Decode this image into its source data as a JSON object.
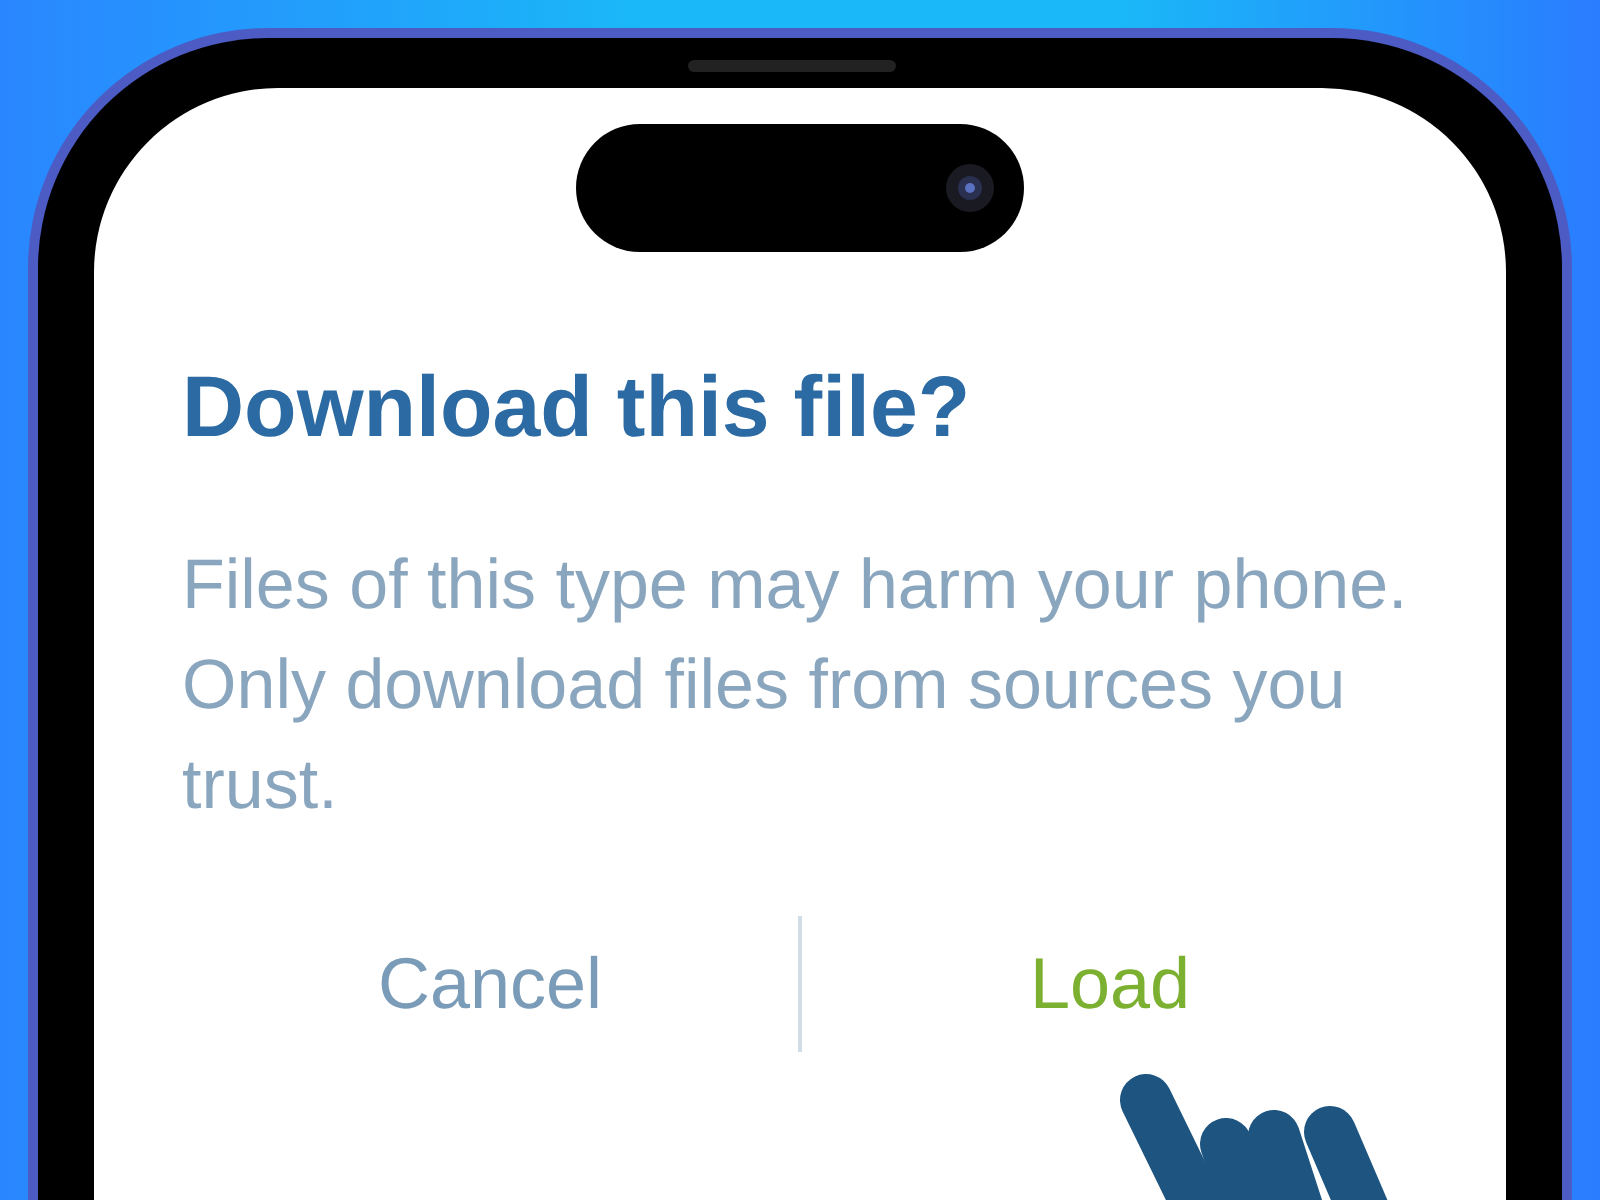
{
  "dialog": {
    "title": "Download this file?",
    "message": "Files of this type may harm your phone. Only download files from sources you trust.",
    "buttons": [
      {
        "label": "Cancel",
        "kind": "cancel"
      },
      {
        "label": "Load",
        "kind": "confirm"
      }
    ]
  }
}
